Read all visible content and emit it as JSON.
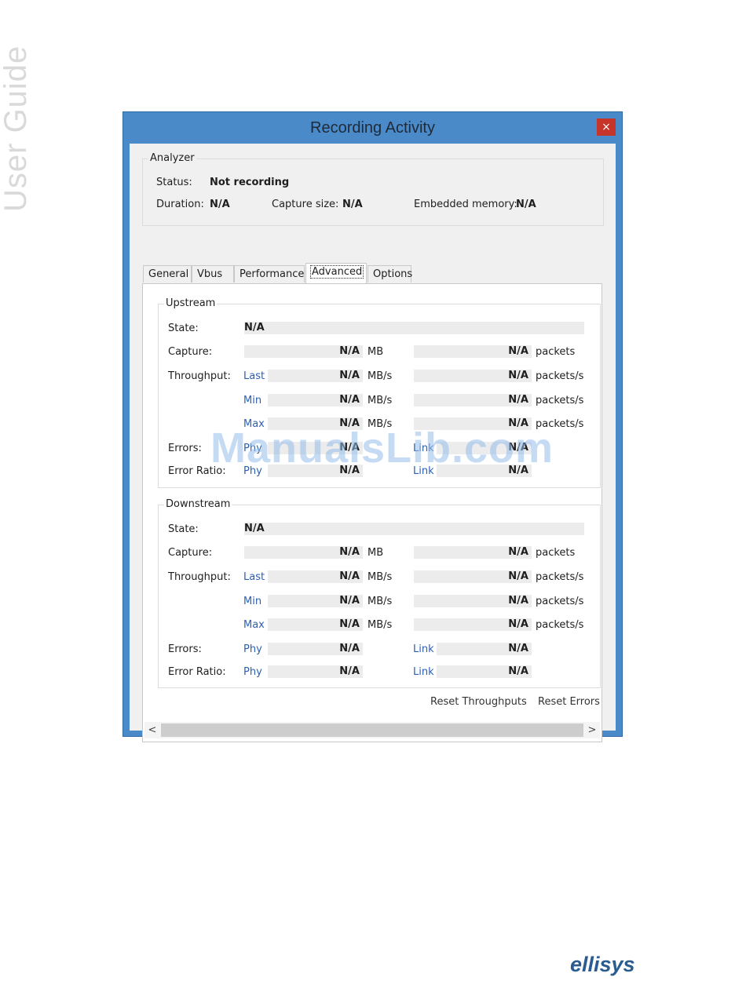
{
  "page": {
    "side_title": "User Guide",
    "watermark": "ManualsLib.com",
    "logo": "ellisys"
  },
  "window": {
    "title": "Recording Activity",
    "close": "×"
  },
  "analyzer": {
    "label": "Analyzer",
    "status_label": "Status:",
    "status_value": "Not recording",
    "duration_label": "Duration:",
    "duration_value": "N/A",
    "capture_label": "Capture size:",
    "capture_value": "N/A",
    "memory_label": "Embedded memory:",
    "memory_value": "N/A"
  },
  "tabs": [
    "General",
    "Vbus",
    "Performance",
    "Advanced",
    "Options"
  ],
  "active_tab": "Advanced",
  "labels": {
    "state": "State:",
    "capture": "Capture:",
    "throughput": "Throughput:",
    "errors": "Errors:",
    "error_ratio": "Error Ratio:",
    "last": "Last",
    "min": "Min",
    "max": "Max",
    "phy": "Phy",
    "link": "Link",
    "mb": "MB",
    "mbs": "MB/s",
    "packets": "packets",
    "packets_s": "packets/s"
  },
  "upstream": {
    "title": "Upstream",
    "state": "N/A",
    "capture_mb": "N/A",
    "capture_packets": "N/A",
    "last_mbs": "N/A",
    "last_packets": "N/A",
    "min_mbs": "N/A",
    "min_packets": "N/A",
    "max_mbs": "N/A",
    "max_packets": "N/A",
    "errors_phy": "N/A",
    "errors_link": "N/A",
    "ratio_phy": "N/A",
    "ratio_link": "N/A"
  },
  "downstream": {
    "title": "Downstream",
    "state": "N/A",
    "capture_mb": "N/A",
    "capture_packets": "N/A",
    "last_mbs": "N/A",
    "last_packets": "N/A",
    "min_mbs": "N/A",
    "min_packets": "N/A",
    "max_mbs": "N/A",
    "max_packets": "N/A",
    "errors_phy": "N/A",
    "errors_link": "N/A",
    "ratio_phy": "N/A",
    "ratio_link": "N/A"
  },
  "buttons": {
    "reset_throughputs": "Reset Throughputs",
    "reset_errors": "Reset Errors"
  },
  "scroll": {
    "left": "<",
    "right": ">"
  }
}
